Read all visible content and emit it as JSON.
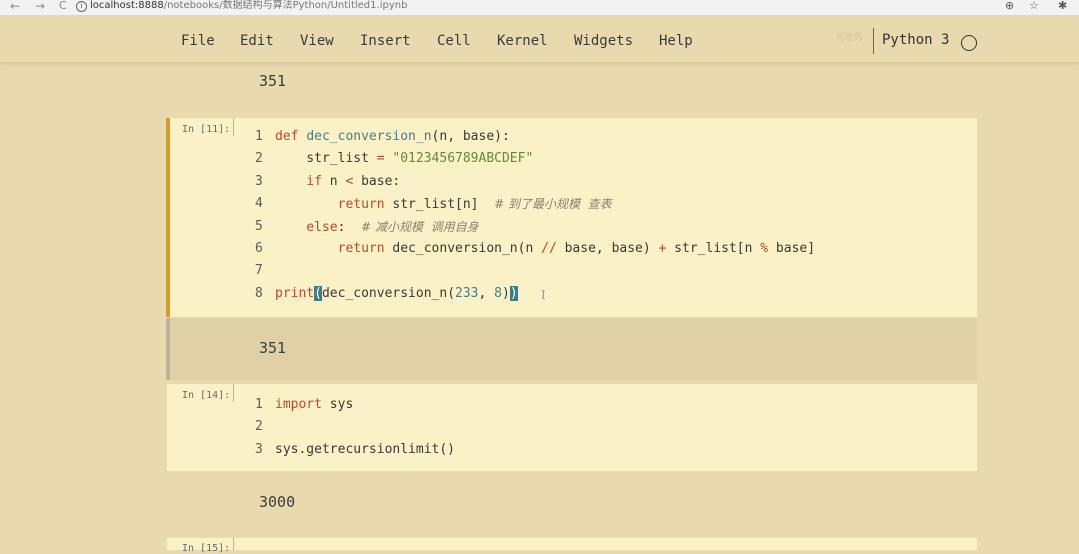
{
  "browser": {
    "back": "←",
    "forward": "→",
    "reload": "C",
    "info_icon": "i",
    "url_domain": "localhost:8888",
    "url_path": "/notebooks/数据结构与算法Python/Untitled1.ipynb",
    "zoom_icon": "⊕",
    "star_icon": "☆",
    "extension_icon": "✱"
  },
  "menu": [
    "File",
    "Edit",
    "View",
    "Insert",
    "Cell",
    "Kernel",
    "Widgets",
    "Help"
  ],
  "kernel": {
    "trusted": "可信的",
    "name": "Python 3"
  },
  "outputs": {
    "top": "351",
    "cell11": "351",
    "cell14": "3000"
  },
  "cells": {
    "c11": {
      "prompt": "In [11]:",
      "lines": [
        {
          "n": "1",
          "parts": [
            [
              "kw",
              "def "
            ],
            [
              "fn",
              "dec_conversion_n"
            ],
            [
              "",
              "(n, base):"
            ]
          ]
        },
        {
          "n": "2",
          "parts": [
            [
              "",
              "    str_list "
            ],
            [
              "op",
              "="
            ],
            [
              "str",
              " \"0123456789ABCDEF\""
            ]
          ]
        },
        {
          "n": "3",
          "parts": [
            [
              "kw",
              "    if "
            ],
            [
              "",
              "n "
            ],
            [
              "op",
              "<"
            ],
            [
              "",
              " base:"
            ]
          ]
        },
        {
          "n": "4",
          "parts": [
            [
              "kw",
              "        return "
            ],
            [
              "",
              "str_list[n]  "
            ],
            [
              "cm",
              "# 到了最小规模  查表"
            ]
          ]
        },
        {
          "n": "5",
          "parts": [
            [
              "kw",
              "    else"
            ],
            [
              "",
              ":  "
            ],
            [
              "cm",
              "# 减小规模  调用自身"
            ]
          ]
        },
        {
          "n": "6",
          "parts": [
            [
              "kw",
              "        return "
            ],
            [
              "",
              "dec_conversion_n(n "
            ],
            [
              "op",
              "//"
            ],
            [
              "",
              " base, base) "
            ],
            [
              "op",
              "+"
            ],
            [
              "",
              " str_list[n "
            ],
            [
              "op",
              "%"
            ],
            [
              "",
              " base]"
            ]
          ]
        },
        {
          "n": "7",
          "parts": []
        },
        {
          "n": "8",
          "parts": [
            [
              "kw",
              "print"
            ],
            [
              "bm",
              "("
            ],
            [
              "",
              "dec_conversion_n("
            ],
            [
              "num",
              "233"
            ],
            [
              "",
              ", "
            ],
            [
              "num",
              "8"
            ],
            [
              "",
              ")"
            ],
            [
              "bm",
              ")"
            ]
          ]
        }
      ]
    },
    "c14": {
      "prompt": "In [14]:",
      "lines": [
        {
          "n": "1",
          "parts": [
            [
              "kw",
              "import "
            ],
            [
              "",
              "sys"
            ]
          ]
        },
        {
          "n": "2",
          "parts": []
        },
        {
          "n": "3",
          "parts": [
            [
              "",
              "sys.getrecursionlimit()"
            ]
          ]
        }
      ]
    },
    "c15": {
      "prompt": "In [15]:"
    }
  },
  "colors": {
    "background": "#e9d9ae",
    "cell_bg": "#fbf1c7",
    "selected_bar": "#d79a2b",
    "keyword": "#b8492f",
    "string": "#5f8a3a",
    "builtin": "#437f8a"
  }
}
